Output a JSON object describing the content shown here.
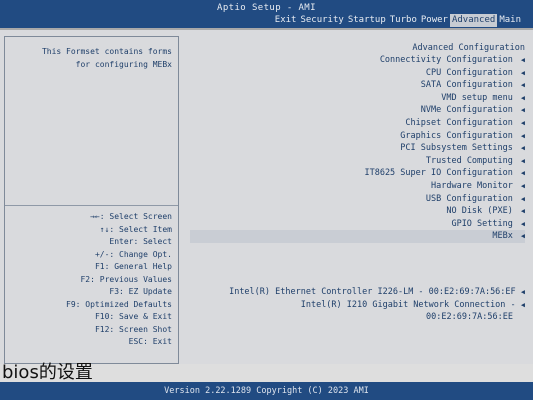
{
  "header": {
    "title": "Aptio Setup - AMI",
    "tabs": [
      "Main",
      "Advanced",
      "Power",
      "Turbo",
      "Startup",
      "Security",
      "Exit"
    ],
    "active_tab": "Advanced"
  },
  "menu": {
    "header": "Advanced Configuration",
    "items": [
      "Connectivity Configuration",
      "CPU Configuration",
      "SATA Configuration",
      "VMD setup menu",
      "NVMe Configuration",
      "Chipset Configuration",
      "Graphics Configuration",
      "PCI Subsystem Settings",
      "Trusted Computing",
      "IT8625 Super IO Configuration",
      "Hardware Monitor",
      "USB Configuration",
      "NO Disk (PXE)",
      "GPIO Setting",
      "MEBx"
    ],
    "selected_index": 14
  },
  "devices": [
    "Intel(R) Ethernet Controller I226-LM - 00:E2:69:7A:56:EF",
    "Intel(R) I210 Gigabit  Network Connection -",
    "00:E2:69:7A:56:EE"
  ],
  "help": {
    "lines": [
      "This Formset contains forms",
      "for configuring MEBx"
    ]
  },
  "keys": [
    "→←: Select Screen",
    "↑↓: Select Item",
    "Enter: Select",
    "+/-: Change Opt.",
    "F1: General Help",
    "F2: Previous Values",
    "F3: EZ Update",
    "F9: Optimized Defaults",
    "F10: Save & Exit",
    "F12: Screen Shot",
    "ESC: Exit"
  ],
  "footer": "Version 2.22.1289 Copyright (C) 2023 AMI",
  "caption": "bios的设置",
  "colors": {
    "header_bg": "#214b82",
    "panel_bg": "#d9dadd",
    "text": "#1f3f6a"
  }
}
